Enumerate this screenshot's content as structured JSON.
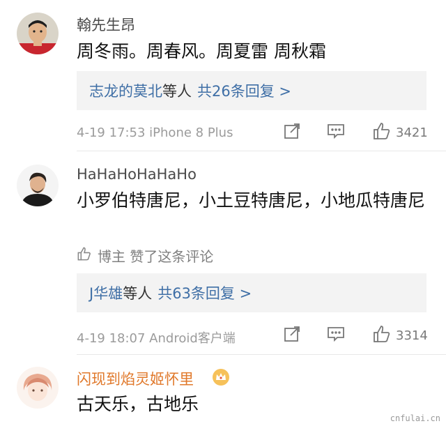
{
  "comments": [
    {
      "username": "翰先生昂",
      "text": "周冬雨。周春风。周夏雷 周秋霜",
      "reply_users": "志龙的莫北",
      "reply_mid": "等人",
      "reply_count": "共26条回复 >",
      "date": "4-19 17:53 iPhone 8 Plus",
      "likes": "3421"
    },
    {
      "username": "HaHaHoHaHaHo",
      "text": "小罗伯特唐尼，小土豆特唐尼，小地瓜特唐尼",
      "author_liked": "博主 赞了这条评论",
      "reply_users": "J华雄",
      "reply_mid": "等人",
      "reply_count": "共63条回复 >",
      "date": "4-19 18:07 Android客户端",
      "likes": "3314"
    },
    {
      "username": "闪现到焰灵姬怀里",
      "text": "古天乐，古地乐"
    }
  ],
  "watermark": "cnfulai.cn",
  "colors": {
    "link": "#3f6fa6",
    "vip_name": "#e0782a",
    "reply_bg": "#f3f3f3"
  }
}
